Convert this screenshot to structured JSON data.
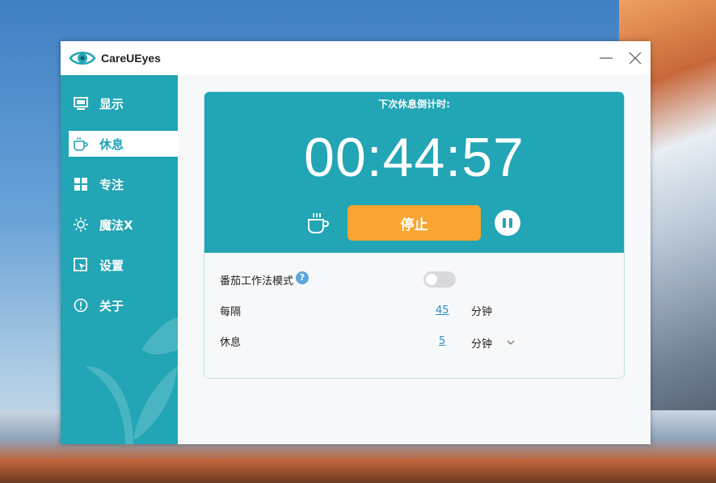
{
  "app": {
    "title": "CareUEyes"
  },
  "sidebar": {
    "items": [
      {
        "label": "显示",
        "icon": "monitor-icon",
        "active": false
      },
      {
        "label": "休息",
        "icon": "coffee-cup-icon",
        "active": true
      },
      {
        "label": "专注",
        "icon": "windows-icon",
        "active": false
      },
      {
        "label": "魔法X",
        "icon": "sun-dim-icon",
        "active": false
      },
      {
        "label": "设置",
        "icon": "cursor-window-icon",
        "active": false
      },
      {
        "label": "关于",
        "icon": "info-circle-icon",
        "active": false
      }
    ]
  },
  "timer": {
    "label": "下次休息倒计时:",
    "value": "00:44:57",
    "stop_label": "停止"
  },
  "settings": {
    "pomodoro_label": "番茄工作法模式",
    "pomodoro_help": "?",
    "pomodoro_enabled": false,
    "interval_label": "每隔",
    "interval_value": "45",
    "interval_unit": "分钟",
    "break_label": "休息",
    "break_value": "5",
    "break_unit": "分钟"
  },
  "colors": {
    "accent": "#22a5b5",
    "stop_button": "#f8a531",
    "link": "#2a8fc8"
  }
}
